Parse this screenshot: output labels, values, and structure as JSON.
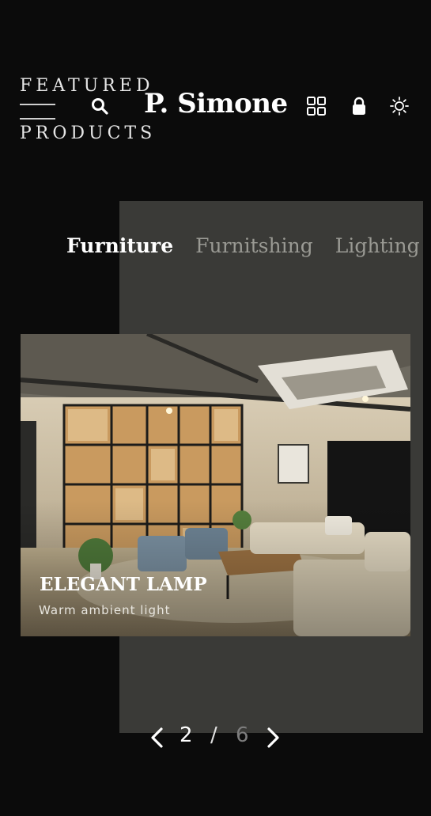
{
  "section_label": {
    "line1": "FEATURED",
    "line2": "PRODUCTS"
  },
  "header": {
    "brand": "P. Simone",
    "icons": [
      "menu-icon",
      "search-icon",
      "grid-icon",
      "bag-icon",
      "sun-icon"
    ]
  },
  "tabs": [
    {
      "label": "Furniture",
      "active": true
    },
    {
      "label": "Furnitshing",
      "active": false
    },
    {
      "label": "Lighting",
      "active": false
    }
  ],
  "slide": {
    "title": "ELEGANT LAMP",
    "subtitle": "Warm ambient light"
  },
  "pager": {
    "current": "2",
    "separator": "/",
    "total": "6"
  },
  "colors": {
    "background": "#0b0b0b",
    "panel": "#3a3a37",
    "active_text": "#ffffff",
    "inactive_text": "#9a9a94"
  }
}
